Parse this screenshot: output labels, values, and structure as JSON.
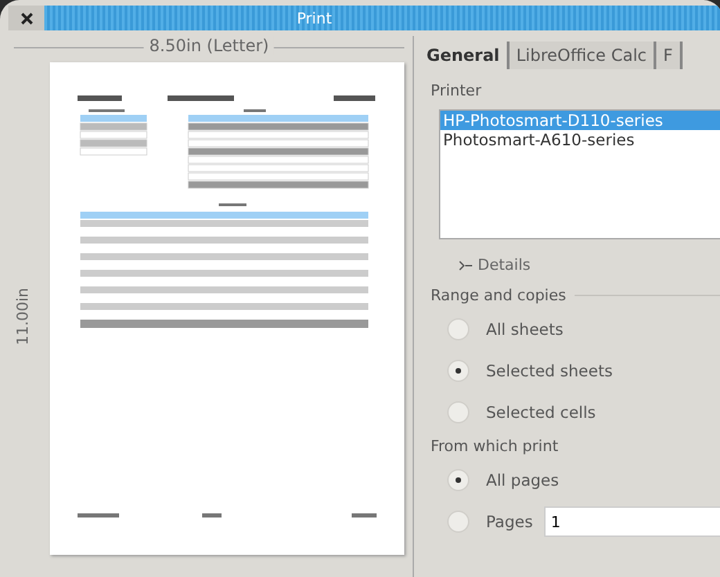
{
  "window": {
    "title": "Print"
  },
  "preview": {
    "width_label": "8.50in (Letter)",
    "height_label": "11.00in"
  },
  "tabs": [
    {
      "label": "General",
      "selected": true
    },
    {
      "label": "LibreOffice Calc",
      "selected": false
    },
    {
      "label": "F",
      "selected": false
    }
  ],
  "printer": {
    "label": "Printer",
    "items": [
      {
        "name": "HP-Photosmart-D110-series",
        "selected": true
      },
      {
        "name": "Photosmart-A610-series",
        "selected": false
      }
    ]
  },
  "details": {
    "label": "Details",
    "expanded": false
  },
  "range": {
    "label": "Range and copies",
    "options": [
      {
        "label": "All sheets",
        "selected": false
      },
      {
        "label": "Selected sheets",
        "selected": true
      },
      {
        "label": "Selected cells",
        "selected": false
      }
    ]
  },
  "from_which": {
    "label": "From which print",
    "options": [
      {
        "label": "All pages",
        "selected": true
      },
      {
        "label": "Pages",
        "selected": false,
        "value": "1"
      }
    ]
  }
}
